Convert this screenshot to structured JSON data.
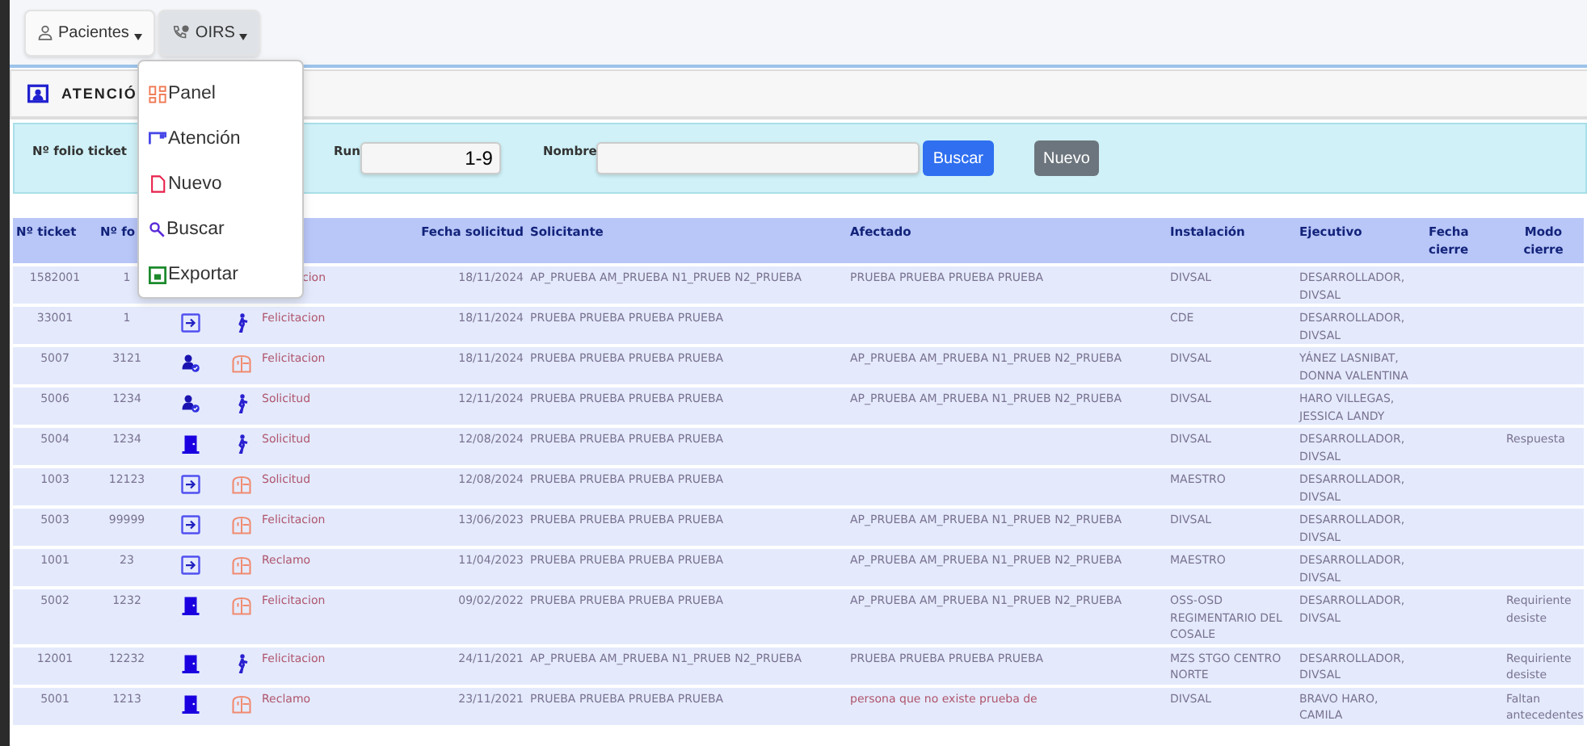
{
  "nav": [
    {
      "label": "Pacientes",
      "kind": "user",
      "open": false
    },
    {
      "label": "OIRS",
      "kind": "phone",
      "open": true
    }
  ],
  "menu": [
    {
      "label": "Panel",
      "kind": "panel"
    },
    {
      "label": "Atención",
      "kind": "attention"
    },
    {
      "label": "Nuevo",
      "kind": "new"
    },
    {
      "label": "Buscar",
      "kind": "search"
    },
    {
      "label": "Exportar",
      "kind": "export"
    }
  ],
  "card_title": "ATENCIÓ",
  "filters": {
    "folio_label": "Nº folio ticket",
    "run_label": "Run",
    "run_value": "1-9",
    "name_label": "Nombre",
    "search_button": "Buscar",
    "new_button": "Nuevo"
  },
  "table": {
    "columns": [
      "Nº ticket",
      "Nº fo",
      "Fecha solicitud",
      "Solicitante",
      "Afectado",
      "Instalación",
      "Ejecutivo",
      "Fecha cierre",
      "Modo cierre"
    ],
    "rows": [
      {
        "covered": true,
        "ticket": "1582001",
        "folio": "1",
        "type": "cion",
        "date": "18/11/2024",
        "applicant": "AP_PRUEBA AM_PRUEBA N1_PRUEB N2_PRUEBA",
        "affected": "PRUEBA PRUEBA PRUEBA PRUEBA",
        "site": "DIVSAL",
        "executive": "DESARROLLADOR, DIVSAL",
        "close_mode": ""
      },
      {
        "covered": false,
        "ticket": "33001",
        "folio": "1",
        "icons": [
          {
            "kind": "arrow"
          },
          {
            "kind": "walk"
          }
        ],
        "type": "Felicitacion",
        "date": "18/11/2024",
        "applicant": "PRUEBA PRUEBA PRUEBA PRUEBA",
        "affected": "",
        "site": "CDE",
        "executive": "DESARROLLADOR, DIVSAL",
        "close_mode": ""
      },
      {
        "covered": false,
        "ticket": "5007",
        "folio": "3121",
        "icons": [
          {
            "kind": "user"
          },
          {
            "kind": "counter"
          }
        ],
        "type": "Felicitacion",
        "date": "18/11/2024",
        "applicant": "PRUEBA PRUEBA PRUEBA PRUEBA",
        "affected": "AP_PRUEBA AM_PRUEBA N1_PRUEB N2_PRUEBA",
        "site": "DIVSAL",
        "executive": "YÁNEZ LASNIBAT, DONNA VALENTINA",
        "close_mode": ""
      },
      {
        "covered": false,
        "ticket": "5006",
        "folio": "1234",
        "icons": [
          {
            "kind": "user"
          },
          {
            "kind": "walk"
          }
        ],
        "type": "Solicitud",
        "date": "12/11/2024",
        "applicant": "PRUEBA PRUEBA PRUEBA PRUEBA",
        "affected": "AP_PRUEBA AM_PRUEBA N1_PRUEB N2_PRUEBA",
        "site": "DIVSAL",
        "executive": "HARO VILLEGAS, JESSICA LANDY",
        "close_mode": ""
      },
      {
        "covered": false,
        "ticket": "5004",
        "folio": "1234",
        "icons": [
          {
            "kind": "door"
          },
          {
            "kind": "walk"
          }
        ],
        "type": "Solicitud",
        "date": "12/08/2024",
        "applicant": "PRUEBA PRUEBA PRUEBA PRUEBA",
        "affected": "",
        "site": "DIVSAL",
        "executive": "DESARROLLADOR, DIVSAL",
        "close_mode": "Respuesta"
      },
      {
        "covered": false,
        "ticket": "1003",
        "folio": "12123",
        "icons": [
          {
            "kind": "arrow"
          },
          {
            "kind": "counter"
          }
        ],
        "type": "Solicitud",
        "date": "12/08/2024",
        "applicant": "PRUEBA PRUEBA PRUEBA PRUEBA",
        "affected": "",
        "site": "MAESTRO",
        "executive": "DESARROLLADOR, DIVSAL",
        "close_mode": ""
      },
      {
        "covered": false,
        "ticket": "5003",
        "folio": "99999",
        "icons": [
          {
            "kind": "arrow"
          },
          {
            "kind": "counter"
          }
        ],
        "type": "Felicitacion",
        "date": "13/06/2023",
        "applicant": "PRUEBA PRUEBA PRUEBA PRUEBA",
        "affected": "AP_PRUEBA AM_PRUEBA N1_PRUEB N2_PRUEBA",
        "site": "DIVSAL",
        "executive": "DESARROLLADOR, DIVSAL",
        "close_mode": ""
      },
      {
        "covered": false,
        "ticket": "1001",
        "folio": "23",
        "icons": [
          {
            "kind": "arrow"
          },
          {
            "kind": "counter"
          }
        ],
        "type": "Reclamo",
        "date": "11/04/2023",
        "applicant": "PRUEBA PRUEBA PRUEBA PRUEBA",
        "affected": "AP_PRUEBA AM_PRUEBA N1_PRUEB N2_PRUEBA",
        "site": "MAESTRO",
        "executive": "DESARROLLADOR, DIVSAL",
        "close_mode": ""
      },
      {
        "covered": false,
        "ticket": "5002",
        "folio": "1232",
        "icons": [
          {
            "kind": "door"
          },
          {
            "kind": "counter"
          }
        ],
        "type": "Felicitacion",
        "date": "09/02/2022",
        "applicant": "PRUEBA PRUEBA PRUEBA PRUEBA",
        "affected": "AP_PRUEBA AM_PRUEBA N1_PRUEB N2_PRUEBA",
        "site": "OSS-OSD REGIMENTARIO DEL COSALE",
        "executive": "DESARROLLADOR, DIVSAL",
        "close_mode": "Requiriente desiste"
      },
      {
        "covered": false,
        "ticket": "12001",
        "folio": "12232",
        "icons": [
          {
            "kind": "door"
          },
          {
            "kind": "walk"
          }
        ],
        "type": "Felicitacion",
        "date": "24/11/2021",
        "applicant": "AP_PRUEBA AM_PRUEBA N1_PRUEB N2_PRUEBA",
        "affected": "PRUEBA PRUEBA PRUEBA PRUEBA",
        "site": "MZS STGO CENTRO NORTE",
        "executive": "DESARROLLADOR, DIVSAL",
        "close_mode": "Requiriente desiste"
      },
      {
        "covered": false,
        "ticket": "5001",
        "folio": "1213",
        "icons": [
          {
            "kind": "door"
          },
          {
            "kind": "counter"
          }
        ],
        "type": "Reclamo",
        "date": "23/11/2021",
        "applicant": "PRUEBA PRUEBA PRUEBA PRUEBA",
        "affected": "persona que no existe prueba de",
        "site": "DIVSAL",
        "executive": "BRAVO HARO, CAMILA",
        "close_mode": "Faltan antecedentes"
      }
    ]
  }
}
